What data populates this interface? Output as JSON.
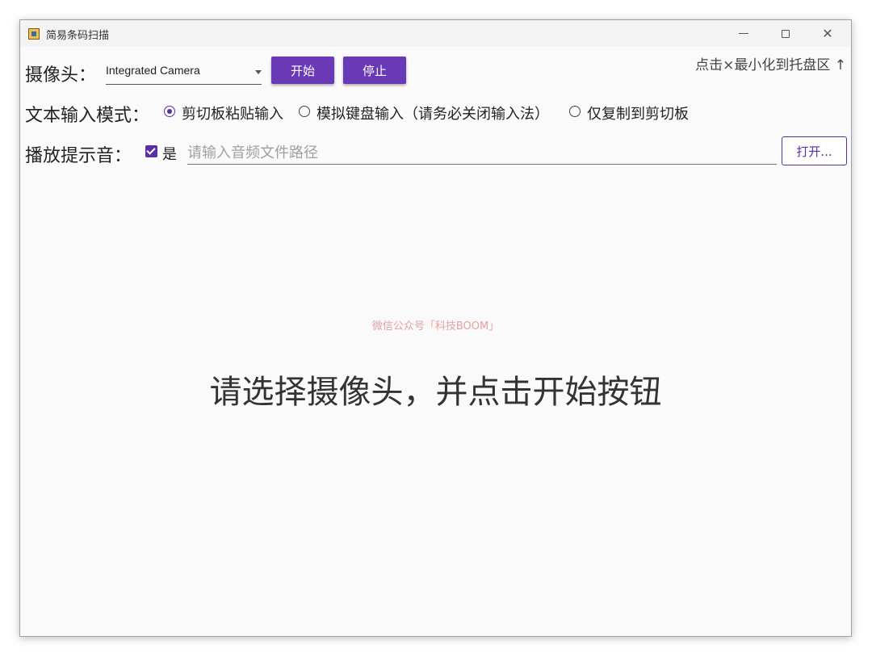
{
  "window": {
    "title": "简易条码扫描",
    "minimize_icon": "minimize-icon",
    "maximize_icon": "maximize-icon",
    "close_icon": "close-icon",
    "close_glyph": "✕"
  },
  "camera": {
    "label": "摄像头：",
    "selected": "Integrated Camera",
    "start_label": "开始",
    "stop_label": "停止"
  },
  "tray_hint": "点击×最小化到托盘区 ↑",
  "text_input_mode": {
    "label": "文本输入模式：",
    "options": [
      {
        "label": "剪切板粘贴输入",
        "checked": true
      },
      {
        "label": "模拟键盘输入（请务必关闭输入法）",
        "checked": false
      },
      {
        "label": "仅复制到剪切板",
        "checked": false
      }
    ]
  },
  "sound": {
    "label": "播放提示音：",
    "enabled_label": "是",
    "enabled": true,
    "path_placeholder": "请输入音频文件路径",
    "open_label": "打开..."
  },
  "watermark": "微信公众号「科技BOOM」",
  "main_message": "请选择摄像头，并点击开始按钮",
  "colors": {
    "accent": "#6a39b6",
    "background": "#fafafa"
  }
}
